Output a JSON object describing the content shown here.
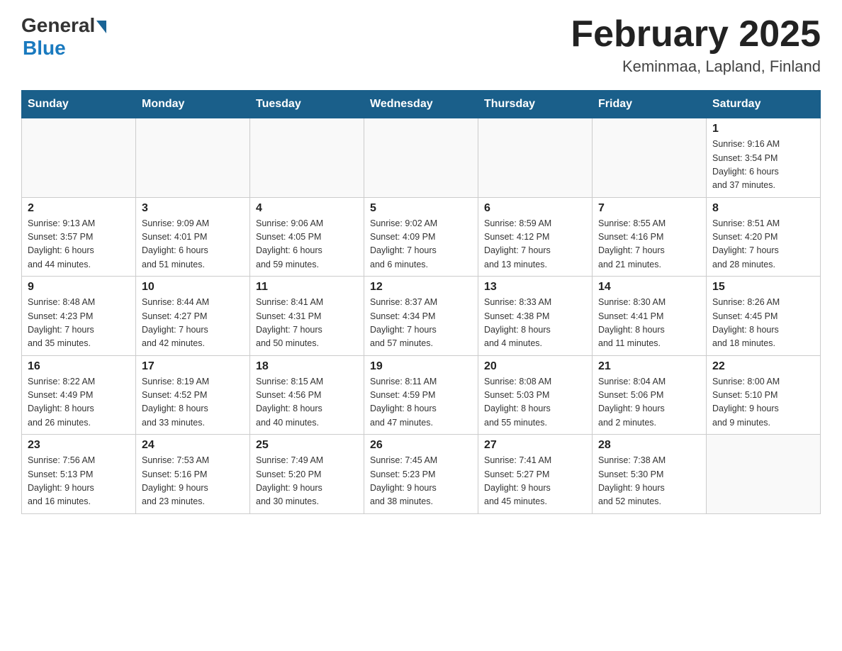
{
  "header": {
    "logo_general": "General",
    "logo_blue": "Blue",
    "month_title": "February 2025",
    "location": "Keminmaa, Lapland, Finland"
  },
  "weekdays": [
    "Sunday",
    "Monday",
    "Tuesday",
    "Wednesday",
    "Thursday",
    "Friday",
    "Saturday"
  ],
  "weeks": [
    [
      {
        "day": "",
        "info": ""
      },
      {
        "day": "",
        "info": ""
      },
      {
        "day": "",
        "info": ""
      },
      {
        "day": "",
        "info": ""
      },
      {
        "day": "",
        "info": ""
      },
      {
        "day": "",
        "info": ""
      },
      {
        "day": "1",
        "info": "Sunrise: 9:16 AM\nSunset: 3:54 PM\nDaylight: 6 hours\nand 37 minutes."
      }
    ],
    [
      {
        "day": "2",
        "info": "Sunrise: 9:13 AM\nSunset: 3:57 PM\nDaylight: 6 hours\nand 44 minutes."
      },
      {
        "day": "3",
        "info": "Sunrise: 9:09 AM\nSunset: 4:01 PM\nDaylight: 6 hours\nand 51 minutes."
      },
      {
        "day": "4",
        "info": "Sunrise: 9:06 AM\nSunset: 4:05 PM\nDaylight: 6 hours\nand 59 minutes."
      },
      {
        "day": "5",
        "info": "Sunrise: 9:02 AM\nSunset: 4:09 PM\nDaylight: 7 hours\nand 6 minutes."
      },
      {
        "day": "6",
        "info": "Sunrise: 8:59 AM\nSunset: 4:12 PM\nDaylight: 7 hours\nand 13 minutes."
      },
      {
        "day": "7",
        "info": "Sunrise: 8:55 AM\nSunset: 4:16 PM\nDaylight: 7 hours\nand 21 minutes."
      },
      {
        "day": "8",
        "info": "Sunrise: 8:51 AM\nSunset: 4:20 PM\nDaylight: 7 hours\nand 28 minutes."
      }
    ],
    [
      {
        "day": "9",
        "info": "Sunrise: 8:48 AM\nSunset: 4:23 PM\nDaylight: 7 hours\nand 35 minutes."
      },
      {
        "day": "10",
        "info": "Sunrise: 8:44 AM\nSunset: 4:27 PM\nDaylight: 7 hours\nand 42 minutes."
      },
      {
        "day": "11",
        "info": "Sunrise: 8:41 AM\nSunset: 4:31 PM\nDaylight: 7 hours\nand 50 minutes."
      },
      {
        "day": "12",
        "info": "Sunrise: 8:37 AM\nSunset: 4:34 PM\nDaylight: 7 hours\nand 57 minutes."
      },
      {
        "day": "13",
        "info": "Sunrise: 8:33 AM\nSunset: 4:38 PM\nDaylight: 8 hours\nand 4 minutes."
      },
      {
        "day": "14",
        "info": "Sunrise: 8:30 AM\nSunset: 4:41 PM\nDaylight: 8 hours\nand 11 minutes."
      },
      {
        "day": "15",
        "info": "Sunrise: 8:26 AM\nSunset: 4:45 PM\nDaylight: 8 hours\nand 18 minutes."
      }
    ],
    [
      {
        "day": "16",
        "info": "Sunrise: 8:22 AM\nSunset: 4:49 PM\nDaylight: 8 hours\nand 26 minutes."
      },
      {
        "day": "17",
        "info": "Sunrise: 8:19 AM\nSunset: 4:52 PM\nDaylight: 8 hours\nand 33 minutes."
      },
      {
        "day": "18",
        "info": "Sunrise: 8:15 AM\nSunset: 4:56 PM\nDaylight: 8 hours\nand 40 minutes."
      },
      {
        "day": "19",
        "info": "Sunrise: 8:11 AM\nSunset: 4:59 PM\nDaylight: 8 hours\nand 47 minutes."
      },
      {
        "day": "20",
        "info": "Sunrise: 8:08 AM\nSunset: 5:03 PM\nDaylight: 8 hours\nand 55 minutes."
      },
      {
        "day": "21",
        "info": "Sunrise: 8:04 AM\nSunset: 5:06 PM\nDaylight: 9 hours\nand 2 minutes."
      },
      {
        "day": "22",
        "info": "Sunrise: 8:00 AM\nSunset: 5:10 PM\nDaylight: 9 hours\nand 9 minutes."
      }
    ],
    [
      {
        "day": "23",
        "info": "Sunrise: 7:56 AM\nSunset: 5:13 PM\nDaylight: 9 hours\nand 16 minutes."
      },
      {
        "day": "24",
        "info": "Sunrise: 7:53 AM\nSunset: 5:16 PM\nDaylight: 9 hours\nand 23 minutes."
      },
      {
        "day": "25",
        "info": "Sunrise: 7:49 AM\nSunset: 5:20 PM\nDaylight: 9 hours\nand 30 minutes."
      },
      {
        "day": "26",
        "info": "Sunrise: 7:45 AM\nSunset: 5:23 PM\nDaylight: 9 hours\nand 38 minutes."
      },
      {
        "day": "27",
        "info": "Sunrise: 7:41 AM\nSunset: 5:27 PM\nDaylight: 9 hours\nand 45 minutes."
      },
      {
        "day": "28",
        "info": "Sunrise: 7:38 AM\nSunset: 5:30 PM\nDaylight: 9 hours\nand 52 minutes."
      },
      {
        "day": "",
        "info": ""
      }
    ]
  ]
}
